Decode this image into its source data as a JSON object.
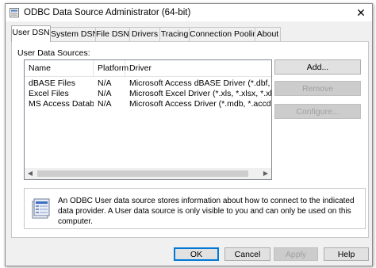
{
  "window": {
    "title": "ODBC Data Source Administrator (64-bit)",
    "close_glyph": "✕"
  },
  "tabs": [
    {
      "label": "User DSN",
      "active": true
    },
    {
      "label": "System DSN"
    },
    {
      "label": "File DSN"
    },
    {
      "label": "Drivers"
    },
    {
      "label": "Tracing"
    },
    {
      "label": "Connection Pooling"
    },
    {
      "label": "About"
    }
  ],
  "user_dsn": {
    "section_label": "User Data Sources:",
    "columns": {
      "name": "Name",
      "platform": "Platform",
      "driver": "Driver"
    },
    "rows": [
      {
        "name": "dBASE Files",
        "platform": "N/A",
        "driver": "Microsoft Access dBASE Driver (*.dbf, *.ndx, *.m"
      },
      {
        "name": "Excel Files",
        "platform": "N/A",
        "driver": "Microsoft Excel Driver (*.xls, *.xlsx, *.xlsm, *.xlsb)"
      },
      {
        "name": "MS Access Database",
        "platform": "N/A",
        "driver": "Microsoft Access Driver (*.mdb, *.accdb)"
      }
    ],
    "buttons": {
      "add": "Add...",
      "remove": "Remove",
      "configure": "Configure..."
    },
    "info_text": "An ODBC User data source stores information about how to connect to the indicated data provider.  A User data source is only visible to you and can only be used on this computer."
  },
  "footer": {
    "ok": "OK",
    "cancel": "Cancel",
    "apply": "Apply",
    "help": "Help"
  },
  "icons": [
    "odbc-app-icon",
    "close-icon",
    "scroll-left-icon",
    "scroll-right-icon",
    "data-source-info-icon"
  ]
}
